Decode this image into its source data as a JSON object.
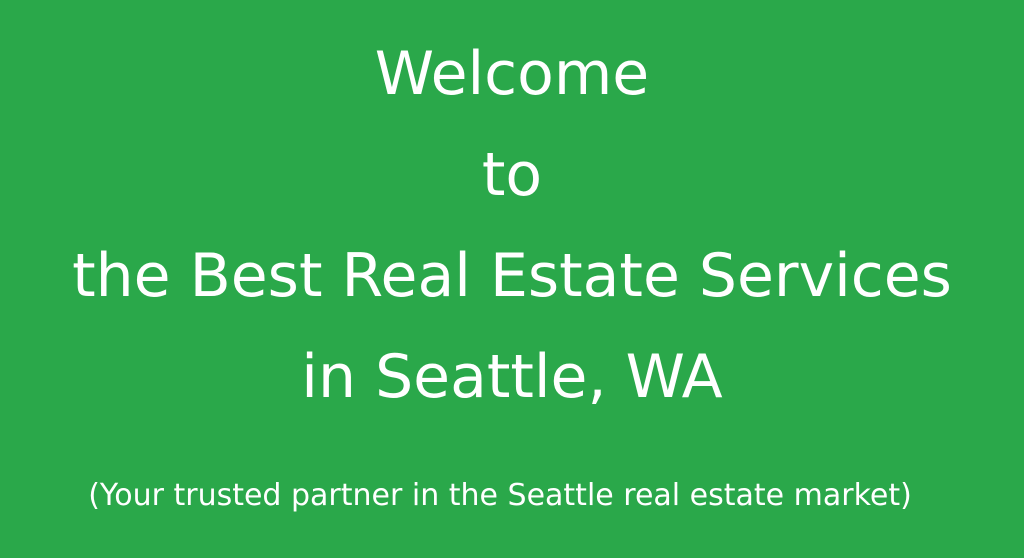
{
  "background_color": "#2aa84a",
  "text_color": "#ffffff",
  "headline": {
    "line1": "Welcome",
    "line2": "to",
    "line3": "the Best Real Estate Services",
    "line4": "in Seattle, WA"
  },
  "tagline": "(Your trusted partner in the Seattle real estate market)"
}
